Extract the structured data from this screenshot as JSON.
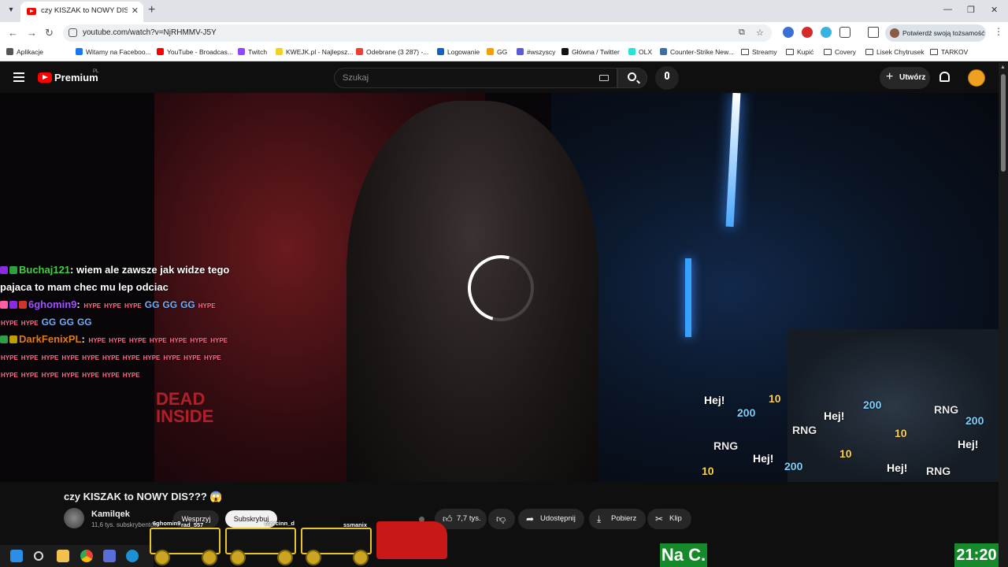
{
  "browser": {
    "tab_title": "czy KISZAK to NOWY DIS??? 😱",
    "url": "youtube.com/watch?v=NjRHMMV-J5Y",
    "identity_label": "Potwierdź swoją tożsamość",
    "bookmarks": [
      {
        "label": "Aplikacje",
        "color": "#555555"
      },
      {
        "label": "Witamy na Faceboo...",
        "color": "#1877f2"
      },
      {
        "label": "YouTube - Broadcas...",
        "color": "#ff0000"
      },
      {
        "label": "Twitch",
        "color": "#9146ff"
      },
      {
        "label": "KWEJK.pl - Najlepsz...",
        "color": "#f5d020"
      },
      {
        "label": "Odebrane (3 287) -...",
        "color": "#ea4335"
      },
      {
        "label": "Logowanie",
        "color": "#0a66c2"
      },
      {
        "label": "GG",
        "color": "#f59f00"
      },
      {
        "label": "#wszyscy",
        "color": "#5b5bd6"
      },
      {
        "label": "Główna / Twitter",
        "color": "#111111"
      },
      {
        "label": "OLX",
        "color": "#23e5db"
      },
      {
        "label": "Counter-Strike New...",
        "color": "#3a6ea5"
      },
      {
        "label": "Streamy",
        "color": "folder"
      },
      {
        "label": "Kupić",
        "color": "folder"
      },
      {
        "label": "Covery",
        "color": "folder"
      },
      {
        "label": "Lisek Chytrusek",
        "color": "folder"
      },
      {
        "label": "TARKOV",
        "color": "folder"
      }
    ]
  },
  "masthead": {
    "brand": "Premium",
    "region": "PL",
    "search_placeholder": "Szukaj",
    "create_label": "Utwórz"
  },
  "video": {
    "overlay_text_left": "DEAD INSIDE",
    "chat": [
      {
        "user": "Buchaj121",
        "user_color": "#3fd13f",
        "message": "wiem ale zawsze jak widze tego pajaca to mam chec mu lep odciac"
      },
      {
        "user": "6ghomin9",
        "user_color": "#a052ff",
        "message": ""
      },
      {
        "user": "DarkFenixPL",
        "user_color": "#e07a1f",
        "message": ""
      }
    ],
    "emote_hype": "HYPE",
    "emote_gg": "G",
    "emote_cloud": [
      "Hej!",
      "200",
      "10",
      "RNG",
      "Hej!",
      "200",
      "10",
      "RNG",
      "Hej!",
      "RNG",
      "Hej!",
      "200",
      "10",
      "Hej!",
      "RNG",
      "200",
      "10"
    ],
    "overlay_na": "Na C.",
    "overlay_time": "21:20"
  },
  "below": {
    "title": "czy KISZAK to NOWY DIS??? 😱",
    "channel_name": "Kamilqek",
    "channel_subs": "11,6 tys. subskrybentów",
    "support_label": "Wesprzyj",
    "subscribed_label": "Subskrybuj",
    "likes": "7,7 tys.",
    "share_label": "Udostępnij",
    "download_label": "Pobierz",
    "clip_label": "Klip"
  },
  "train": {
    "cars": [
      "6ghomin9",
      "rad_557",
      "marcinn_d",
      "ssmanix"
    ]
  }
}
